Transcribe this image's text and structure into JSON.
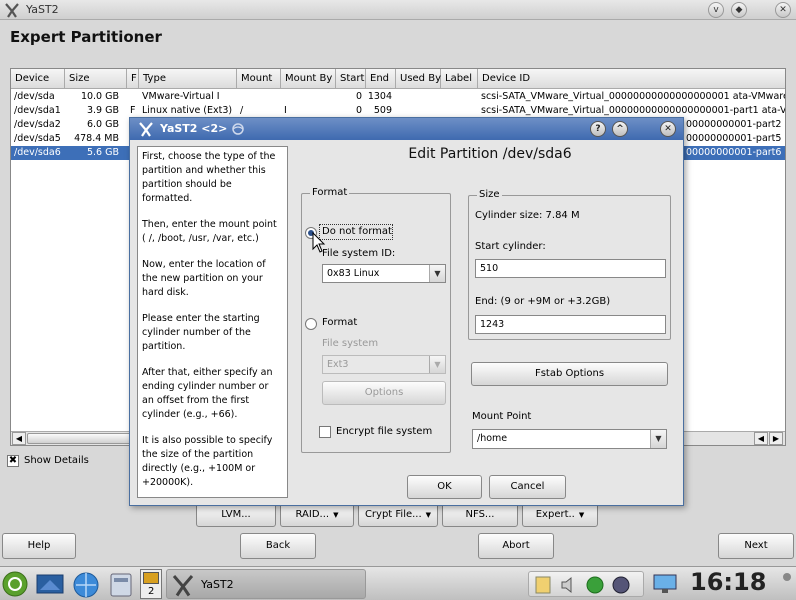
{
  "window": {
    "title": "YaST2"
  },
  "page": {
    "title": "Expert Partitioner"
  },
  "table": {
    "columns": [
      "Device",
      "Size",
      "F",
      "Type",
      "Mount",
      "Mount By",
      "Start",
      "End",
      "Used By",
      "Label",
      "Device ID"
    ],
    "rows": [
      {
        "device": "/dev/sda",
        "size": "10.0 GB",
        "f": "",
        "type": "VMware-Virtual I",
        "mount": "",
        "mountby": "",
        "start": "0",
        "end": "1304",
        "usedby": "",
        "label": "",
        "deviceid": "scsi-SATA_VMware_Virtual_00000000000000000001 ata-VMware"
      },
      {
        "device": "/dev/sda1",
        "size": "3.9 GB",
        "f": "F",
        "type": "Linux native (Ext3)",
        "mount": "/",
        "mountby": "I",
        "start": "0",
        "end": "509",
        "usedby": "",
        "label": "",
        "deviceid": "scsi-SATA_VMware_Virtual_00000000000000000001-part1 ata-V"
      },
      {
        "device": "/dev/sda2",
        "size": "6.0 GB",
        "f": "",
        "type": "",
        "mount": "",
        "mountby": "",
        "start": "",
        "end": "",
        "usedby": "",
        "label": "",
        "deviceid": "00000000001-part2 ata-V"
      },
      {
        "device": "/dev/sda5",
        "size": "478.4 MB",
        "f": "",
        "type": "",
        "mount": "",
        "mountby": "",
        "start": "",
        "end": "",
        "usedby": "",
        "label": "",
        "deviceid": "00000000001-part5 ata-V"
      },
      {
        "device": "/dev/sda6",
        "size": "5.6 GB",
        "f": "",
        "type": "",
        "mount": "",
        "mountby": "",
        "start": "",
        "end": "",
        "usedby": "",
        "label": "",
        "deviceid": "00000000001-part6 ata-V",
        "selected": true
      }
    ]
  },
  "show_details": {
    "label": "Show Details",
    "checked": true,
    "mark": "✖"
  },
  "toolbar": {
    "lvm": "LVM...",
    "raid": "RAID...",
    "crypt": "Crypt File...",
    "nfs": "NFS...",
    "expert": "Expert..",
    "help": "Help",
    "back": "Back",
    "abort": "Abort",
    "next": "Next"
  },
  "dialog": {
    "title": "YaST2 <2>",
    "heading": "Edit Partition /dev/sda6",
    "help_paragraphs": [
      "First, choose the type of the partition and whether this partition should be formatted.",
      "Then, enter the mount point ( /, /boot, /usr, /var, etc.)",
      "Now, enter the location of the new partition on your hard disk.",
      "Please enter the starting cylinder number of the partition.",
      "After that, either specify an ending cylinder number or an offset from the first cylinder (e.g., +66).",
      "It is also possible to specify the size of the partition directly (e.g., +100M or +20000K)."
    ],
    "format": {
      "group_label": "Format",
      "do_not_format": "Do not format",
      "fs_id_label": "File system ID:",
      "fs_id_value": "0x83 Linux",
      "format_label": "Format",
      "fs_label": "File system",
      "fs_value": "Ext3",
      "options": "Options",
      "encrypt": "Encrypt file system"
    },
    "size": {
      "group_label": "Size",
      "cylinder_size": "Cylinder size: 7.84 M",
      "start_label": "Start cylinder:",
      "start_value": "510",
      "end_label": "End:  (9 or +9M or +3.2GB)",
      "end_value": "1243"
    },
    "fstab": "Fstab Options",
    "mount_label": "Mount Point",
    "mount_value": "/home",
    "ok": "OK",
    "cancel": "Cancel"
  },
  "taskbar": {
    "task_label": "YaST2",
    "desktop_num": "2",
    "clock": "16:18"
  },
  "icons": {
    "arrow_down": "▼",
    "arrow_left": "◀",
    "arrow_right": "▶",
    "help_glyph": "?",
    "up_glyph": "^",
    "close_glyph": "✕",
    "down_glyph": "v"
  }
}
